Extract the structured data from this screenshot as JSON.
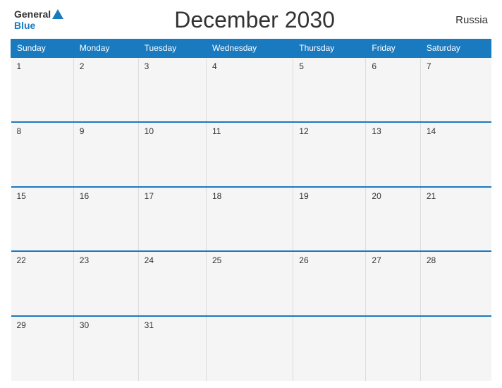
{
  "header": {
    "title": "December 2030",
    "country": "Russia",
    "logo": {
      "general": "General",
      "blue": "Blue"
    }
  },
  "weekdays": [
    "Sunday",
    "Monday",
    "Tuesday",
    "Wednesday",
    "Thursday",
    "Friday",
    "Saturday"
  ],
  "weeks": [
    [
      "1",
      "2",
      "3",
      "4",
      "5",
      "6",
      "7"
    ],
    [
      "8",
      "9",
      "10",
      "11",
      "12",
      "13",
      "14"
    ],
    [
      "15",
      "16",
      "17",
      "18",
      "19",
      "20",
      "21"
    ],
    [
      "22",
      "23",
      "24",
      "25",
      "26",
      "27",
      "28"
    ],
    [
      "29",
      "30",
      "31",
      "",
      "",
      "",
      ""
    ]
  ],
  "colors": {
    "header_bg": "#1a7abf",
    "header_text": "#ffffff",
    "row_bg": "#f5f5f5",
    "border": "#1a7abf",
    "text": "#333333"
  }
}
